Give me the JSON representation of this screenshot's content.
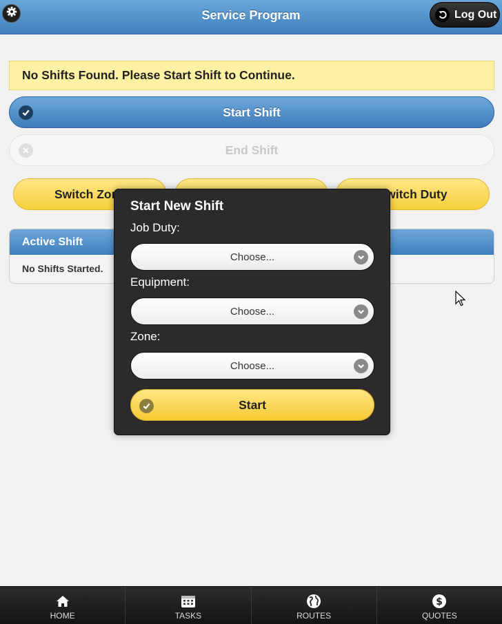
{
  "header": {
    "title": "Service Program",
    "logout_label": "Log Out"
  },
  "notice": "No Shifts Found. Please Start Shift to Continue.",
  "actions": {
    "start_shift": "Start Shift",
    "end_shift": "End Shift"
  },
  "switch_buttons": {
    "zone": "Switch Zone",
    "middle": "",
    "duty": "Switch Duty"
  },
  "active_panel": {
    "title": "Active Shift",
    "body": "No Shifts Started."
  },
  "dialog": {
    "title": "Start New Shift",
    "fields": [
      {
        "label": "Job Duty:",
        "value": "Choose..."
      },
      {
        "label": "Equipment:",
        "value": "Choose..."
      },
      {
        "label": "Zone:",
        "value": "Choose..."
      }
    ],
    "start_label": "Start"
  },
  "nav": [
    {
      "label": "HOME",
      "icon": "home-icon"
    },
    {
      "label": "TASKS",
      "icon": "calendar-icon"
    },
    {
      "label": "ROUTES",
      "icon": "globe-icon"
    },
    {
      "label": "QUOTES",
      "icon": "dollar-icon"
    }
  ],
  "colors": {
    "header_blue": "#4a8ac8",
    "accent_yellow": "#f7cf3c",
    "notice_bg": "#fdf1a3",
    "dialog_bg": "#2b2b2b"
  }
}
